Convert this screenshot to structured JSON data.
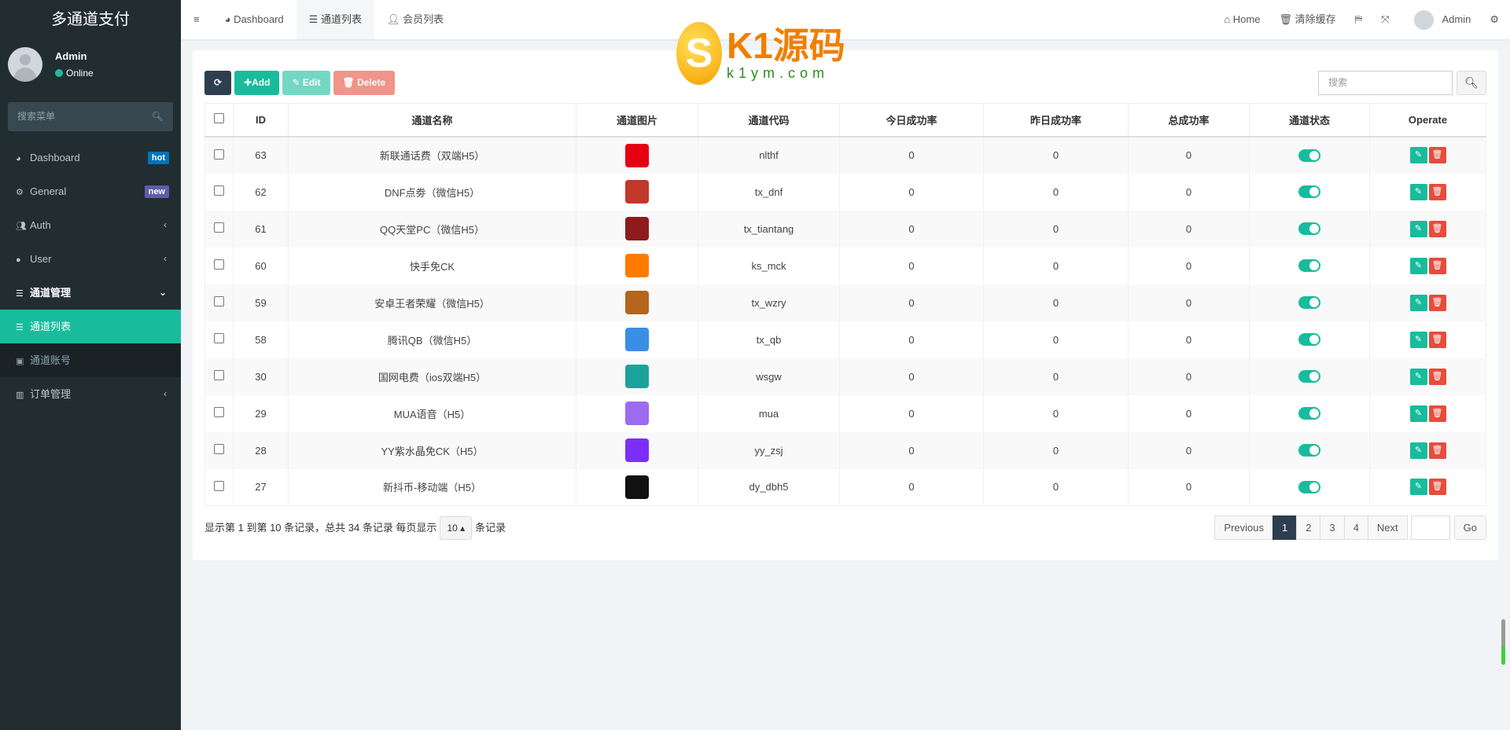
{
  "app": {
    "title": "多通道支付"
  },
  "user": {
    "name": "Admin",
    "status": "Online"
  },
  "sidebar": {
    "search_placeholder": "搜索菜单",
    "items": [
      {
        "label": "Dashboard",
        "badge": "hot",
        "badge_color": "#0073b7"
      },
      {
        "label": "General",
        "badge": "new",
        "badge_color": "#605ca8"
      },
      {
        "label": "Auth"
      },
      {
        "label": "User"
      },
      {
        "label": "通道管理"
      },
      {
        "label": "通道列表"
      },
      {
        "label": "通道账号"
      },
      {
        "label": "订单管理"
      }
    ]
  },
  "topbar": {
    "tabs": [
      "Dashboard",
      "通道列表",
      "会员列表"
    ],
    "home": "Home",
    "clear_cache": "清除缓存",
    "user": "Admin"
  },
  "toolbar": {
    "add": "Add",
    "edit": "Edit",
    "delete": "Delete",
    "search_placeholder": "搜索"
  },
  "table": {
    "headers": [
      "ID",
      "通道名称",
      "通道图片",
      "通道代码",
      "今日成功率",
      "昨日成功率",
      "总成功率",
      "通道状态",
      "Operate"
    ],
    "rows": [
      {
        "id": "63",
        "name": "新联通话费（双端H5）",
        "code": "nlthf",
        "today": "0",
        "yesterday": "0",
        "total": "0",
        "img_color": "#e60012"
      },
      {
        "id": "62",
        "name": "DNF点劵（微信H5）",
        "code": "tx_dnf",
        "today": "0",
        "yesterday": "0",
        "total": "0",
        "img_color": "#c0392b"
      },
      {
        "id": "61",
        "name": "QQ天堂PC（微信H5）",
        "code": "tx_tiantang",
        "today": "0",
        "yesterday": "0",
        "total": "0",
        "img_color": "#8e1b1b"
      },
      {
        "id": "60",
        "name": "快手免CK",
        "code": "ks_mck",
        "today": "0",
        "yesterday": "0",
        "total": "0",
        "img_color": "#ff7b00"
      },
      {
        "id": "59",
        "name": "安卓王者荣耀（微信H5）",
        "code": "tx_wzry",
        "today": "0",
        "yesterday": "0",
        "total": "0",
        "img_color": "#b5651d"
      },
      {
        "id": "58",
        "name": "腾讯QB（微信H5）",
        "code": "tx_qb",
        "today": "0",
        "yesterday": "0",
        "total": "0",
        "img_color": "#3a8ee6"
      },
      {
        "id": "30",
        "name": "国网电费（ios双端H5）",
        "code": "wsgw",
        "today": "0",
        "yesterday": "0",
        "total": "0",
        "img_color": "#1aa39a"
      },
      {
        "id": "29",
        "name": "MUA语音（H5）",
        "code": "mua",
        "today": "0",
        "yesterday": "0",
        "total": "0",
        "img_color": "#9b6cf0"
      },
      {
        "id": "28",
        "name": "YY紫水晶免CK（H5）",
        "code": "yy_zsj",
        "today": "0",
        "yesterday": "0",
        "total": "0",
        "img_color": "#7b2ff7"
      },
      {
        "id": "27",
        "name": "新抖币-移动端（H5）",
        "code": "dy_dbh5",
        "today": "0",
        "yesterday": "0",
        "total": "0",
        "img_color": "#111111"
      }
    ]
  },
  "footer": {
    "info_prefix": "显示第 1 到第 10 条记录，总共 34 条记录 每页显示",
    "page_size": "10",
    "info_suffix": "条记录"
  },
  "pager": {
    "prev": "Previous",
    "pages": [
      "1",
      "2",
      "3",
      "4"
    ],
    "current": "1",
    "next": "Next",
    "go": "Go"
  },
  "watermark": {
    "brand": "K1源码",
    "url": "k1ym.com"
  },
  "colors": {
    "primary": "#18bc9c",
    "dark": "#2c3e50",
    "danger": "#e74c3c",
    "sidebar": "#222d32"
  }
}
